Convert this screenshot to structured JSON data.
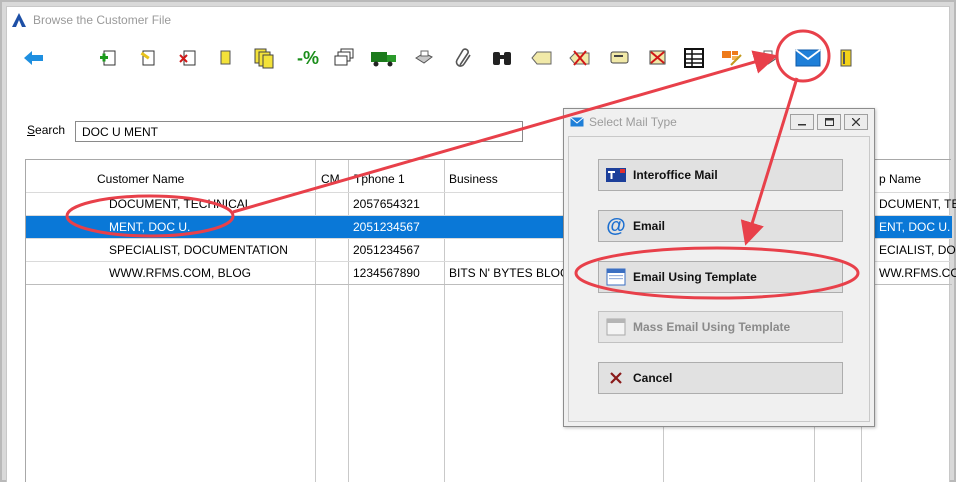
{
  "window": {
    "title": "Browse the Customer File"
  },
  "toolbar": {
    "icons": [
      "back-arrow-icon",
      "add-record-icon",
      "edit-record-icon",
      "delete-record-icon",
      "note-icon",
      "copy-records-icon",
      "percent-icon",
      "windows-icon",
      "truck-icon",
      "printer-icon",
      "attach-icon",
      "binoculars-icon",
      "tag-icon",
      "tag-delete-icon",
      "label-icon",
      "record-delete-icon",
      "table-icon",
      "chart-edit-icon",
      "print-icon",
      "mail-icon",
      "notebook-icon"
    ],
    "percent_label": "-%"
  },
  "search": {
    "label_first": "S",
    "label_rest": "earch",
    "value": "DOC U MENT"
  },
  "grid": {
    "columns": [
      "Customer Name",
      "CM",
      "Tphone 1",
      "Business",
      "p Name"
    ],
    "rows": [
      {
        "name": "DOCUMENT, TECHNICAL",
        "cm": "",
        "phone": "2057654321",
        "business": "",
        "pname": "DCUMENT, TEC"
      },
      {
        "name": "MENT, DOC U.",
        "cm": "",
        "phone": "2051234567",
        "business": "",
        "pname": "ENT, DOC U."
      },
      {
        "name": "SPECIALIST, DOCUMENTATION",
        "cm": "",
        "phone": "2051234567",
        "business": "",
        "pname": "ECIALIST, DOCU"
      },
      {
        "name": "WWW.RFMS.COM, BLOG",
        "cm": "",
        "phone": "1234567890",
        "business": "BITS N' BYTES BLOG",
        "pname": "WW.RFMS.COM"
      }
    ],
    "selected_row": 1
  },
  "dialog": {
    "title": "Select Mail Type",
    "buttons": [
      {
        "label": "Interoffice Mail",
        "enabled": true
      },
      {
        "label": "Email",
        "enabled": true
      },
      {
        "label": "Email Using Template",
        "enabled": true
      },
      {
        "label": "Mass Email Using Template",
        "enabled": false
      },
      {
        "label": "Cancel",
        "enabled": true
      }
    ]
  },
  "colors": {
    "selection": "#0a78d7",
    "annotation": "#e8404a"
  }
}
